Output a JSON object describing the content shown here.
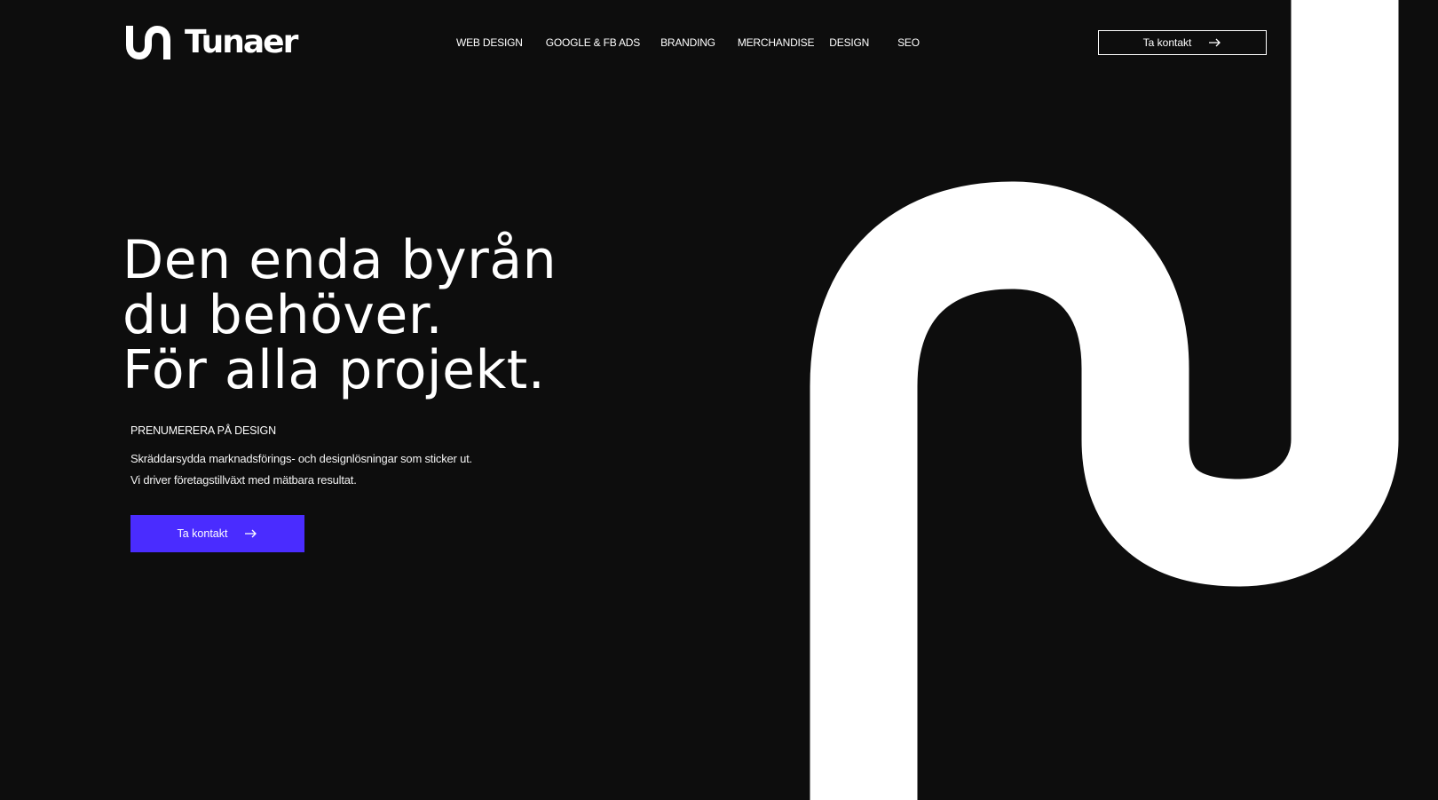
{
  "brand": {
    "name": "Tunaer"
  },
  "nav": {
    "items": [
      {
        "label": "WEB DESIGN"
      },
      {
        "label": "GOOGLE & FB ADS"
      },
      {
        "label": "BRANDING"
      },
      {
        "label": "MERCHANDISE"
      },
      {
        "label": "DESIGN"
      },
      {
        "label": "SEO"
      }
    ],
    "cta_label": "Ta kontakt"
  },
  "hero": {
    "title_lines": [
      "Den enda byrån",
      "du behöver.",
      "För alla projekt."
    ],
    "eyebrow": "PRENUMERERA PÅ DESIGN",
    "description_lines": [
      "Skräddarsydda marknadsförings- och designlösningar som sticker ut.",
      "Vi driver företagstillväxt med mätbara resultat."
    ],
    "cta_label": "Ta kontakt"
  },
  "icons": {
    "header_cta": "arrow-right-icon",
    "hero_cta": "arrow-right-icon",
    "logo": "logo-mark-icon"
  },
  "colors": {
    "background": "#0d0d0d",
    "text": "#ffffff",
    "accent": "#4a2cff"
  }
}
